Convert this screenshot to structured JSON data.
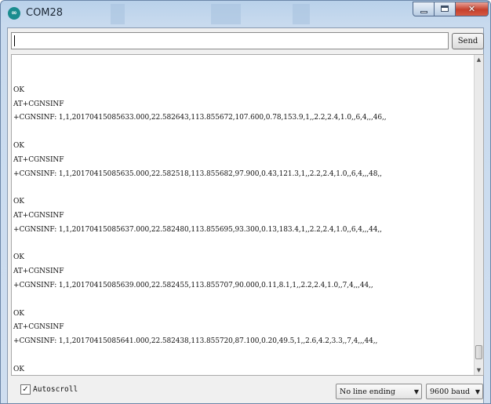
{
  "window": {
    "title": "COM28"
  },
  "input": {
    "value": "",
    "send_label": "Send"
  },
  "output": {
    "lines": [
      "",
      "OK",
      "AT+CGNSINF",
      "+CGNSINF: 1,1,20170415085633.000,22.582643,113.855672,107.600,0.78,153.9,1,,2.2,2.4,1.0,,6,4,,,46,,",
      "",
      "OK",
      "AT+CGNSINF",
      "+CGNSINF: 1,1,20170415085635.000,22.582518,113.855682,97.900,0.43,121.3,1,,2.2,2.4,1.0,,6,4,,,48,,",
      "",
      "OK",
      "AT+CGNSINF",
      "+CGNSINF: 1,1,20170415085637.000,22.582480,113.855695,93.300,0.13,183.4,1,,2.2,2.4,1.0,,6,4,,,44,,",
      "",
      "OK",
      "AT+CGNSINF",
      "+CGNSINF: 1,1,20170415085639.000,22.582455,113.855707,90.000,0.11,8.1,1,,2.2,2.4,1.0,,7,4,,,44,,",
      "",
      "OK",
      "AT+CGNSINF",
      "+CGNSINF: 1,1,20170415085641.000,22.582438,113.855720,87.100,0.20,49.5,1,,2.6,4.2,3.3,,7,4,,,44,,",
      "",
      "OK"
    ]
  },
  "footer": {
    "autoscroll_label": "Autoscroll",
    "autoscroll_checked": "✓",
    "line_ending": "No line ending",
    "baud": "9600 baud"
  },
  "icons": {
    "app": "arduino-icon",
    "minimize": "minimize-icon",
    "maximize": "maximize-icon",
    "close": "close-icon",
    "dropdown": "chevron-down-icon"
  },
  "colors": {
    "title_bar": "#b9d1ea",
    "close_button": "#c6402c"
  }
}
